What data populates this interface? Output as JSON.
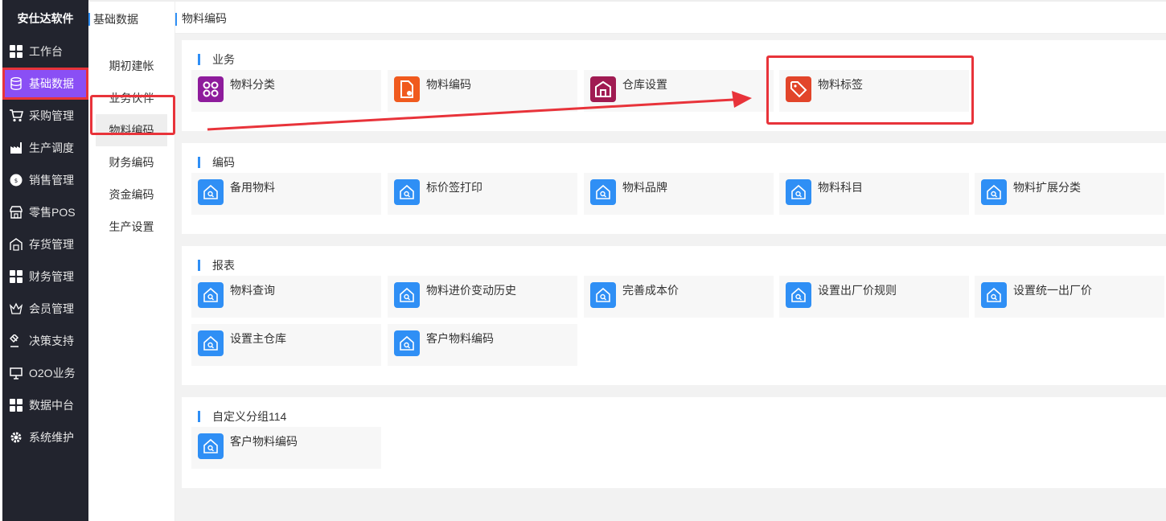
{
  "sidebar": {
    "brand": "安仕达软件",
    "items": [
      {
        "label": "工作台",
        "icon": "grid-icon"
      },
      {
        "label": "基础数据",
        "icon": "database-icon"
      },
      {
        "label": "采购管理",
        "icon": "cart-icon"
      },
      {
        "label": "生产调度",
        "icon": "factory-icon"
      },
      {
        "label": "销售管理",
        "icon": "sale-badge-icon"
      },
      {
        "label": "零售POS",
        "icon": "store-icon"
      },
      {
        "label": "存货管理",
        "icon": "warehouse-icon"
      },
      {
        "label": "财务管理",
        "icon": "grid-icon"
      },
      {
        "label": "会员管理",
        "icon": "crown-icon"
      },
      {
        "label": "决策支持",
        "icon": "gavel-icon"
      },
      {
        "label": "O2O业务",
        "icon": "monitor-icon"
      },
      {
        "label": "数据中台",
        "icon": "grid-icon"
      },
      {
        "label": "系统维护",
        "icon": "gear-icon"
      }
    ]
  },
  "submenu": {
    "title": "基础数据",
    "items": [
      "期初建帐",
      "业务伙伴",
      "物料编码",
      "财务编码",
      "资金编码",
      "生产设置"
    ]
  },
  "page": {
    "title": "物料编码"
  },
  "groups": [
    {
      "title": "业务",
      "cards": [
        {
          "label": "物料分类",
          "color": "#8e1c9c",
          "icon": "category-icon"
        },
        {
          "label": "物料编码",
          "color": "#f05a1e",
          "icon": "file-gear-icon"
        },
        {
          "label": "仓库设置",
          "color": "#a01b52",
          "icon": "warehouse-icon"
        },
        {
          "label": "物料标签",
          "color": "#e2452a",
          "icon": "tag-icon"
        }
      ]
    },
    {
      "title": "编码",
      "cards": [
        {
          "label": "备用物料",
          "color": "#2f8ff5",
          "icon": "home-search-icon"
        },
        {
          "label": "标价签打印",
          "color": "#2f8ff5",
          "icon": "home-search-icon"
        },
        {
          "label": "物料品牌",
          "color": "#2f8ff5",
          "icon": "home-search-icon"
        },
        {
          "label": "物料科目",
          "color": "#2f8ff5",
          "icon": "home-search-icon"
        },
        {
          "label": "物料扩展分类",
          "color": "#2f8ff5",
          "icon": "home-search-icon"
        }
      ]
    },
    {
      "title": "报表",
      "cards": [
        {
          "label": "物料查询",
          "color": "#2f8ff5",
          "icon": "home-search-icon"
        },
        {
          "label": "物料进价变动历史",
          "color": "#2f8ff5",
          "icon": "home-search-icon"
        },
        {
          "label": "完善成本价",
          "color": "#2f8ff5",
          "icon": "home-search-icon"
        },
        {
          "label": "设置出厂价规则",
          "color": "#2f8ff5",
          "icon": "home-search-icon"
        },
        {
          "label": "设置统一出厂价",
          "color": "#2f8ff5",
          "icon": "home-search-icon"
        },
        {
          "label": "设置主仓库",
          "color": "#2f8ff5",
          "icon": "home-search-icon"
        },
        {
          "label": "客户物料编码",
          "color": "#2f8ff5",
          "icon": "home-search-icon"
        }
      ]
    },
    {
      "title": "自定义分组114",
      "cards": [
        {
          "label": "客户物料编码",
          "color": "#2f8ff5",
          "icon": "home-search-icon"
        }
      ]
    }
  ]
}
